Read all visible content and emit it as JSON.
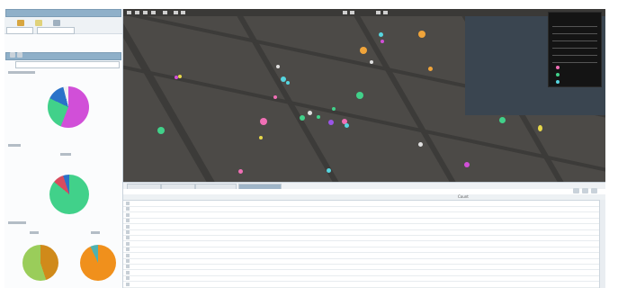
{
  "left_panel": {
    "title": "",
    "section_title": "",
    "dropdown_value": "",
    "pie_labels": [
      "",
      "",
      "",
      ""
    ]
  },
  "map": {
    "legend_title": "",
    "legend_items": [
      "",
      "",
      "",
      "",
      "",
      "",
      "",
      "",
      ""
    ],
    "marker_colors": {
      "magenta": "#d14fd8",
      "orange": "#f0a43a",
      "green": "#41d18a",
      "cyan": "#56d6e0",
      "pink": "#f06fb5",
      "yellow": "#e8d84a",
      "purple": "#9a55e8"
    }
  },
  "bottom_tabs": [
    "",
    "",
    "",
    ""
  ],
  "table": {
    "columns": [
      "",
      "",
      "",
      "",
      "",
      "Count",
      ""
    ],
    "rows": [
      [
        "",
        "",
        "",
        "",
        "",
        "",
        ""
      ],
      [
        "",
        "",
        "",
        "",
        "",
        "",
        ""
      ],
      [
        "",
        "",
        "",
        "",
        "",
        "",
        ""
      ],
      [
        "",
        "",
        "",
        "",
        "",
        "",
        ""
      ],
      [
        "",
        "",
        "",
        "",
        "",
        "",
        ""
      ],
      [
        "",
        "",
        "",
        "",
        "",
        "",
        ""
      ],
      [
        "",
        "",
        "",
        "",
        "",
        "",
        ""
      ],
      [
        "",
        "",
        "",
        "",
        "",
        "",
        ""
      ],
      [
        "",
        "",
        "",
        "",
        "",
        "",
        ""
      ],
      [
        "",
        "",
        "",
        "",
        "",
        "",
        ""
      ],
      [
        "",
        "",
        "",
        "",
        "",
        "",
        ""
      ],
      [
        "",
        "",
        "",
        "",
        "",
        "",
        ""
      ],
      [
        "",
        "",
        "",
        "",
        "",
        "",
        ""
      ],
      [
        "",
        "",
        "",
        "",
        "",
        "",
        ""
      ],
      [
        "",
        "",
        "",
        "",
        "",
        "",
        ""
      ]
    ]
  },
  "pie_colors": {
    "pie1": [
      "#d14fd8",
      "#41d18a",
      "#2a72c9",
      "#f0f0f0"
    ],
    "pie2": [
      "#41d18a",
      "#d84b5d",
      "#2a72c9"
    ],
    "pie3": [
      "#d08a1a",
      "#9acd5a"
    ],
    "pie4": [
      "#f0901c",
      "#4fb2b0"
    ]
  }
}
